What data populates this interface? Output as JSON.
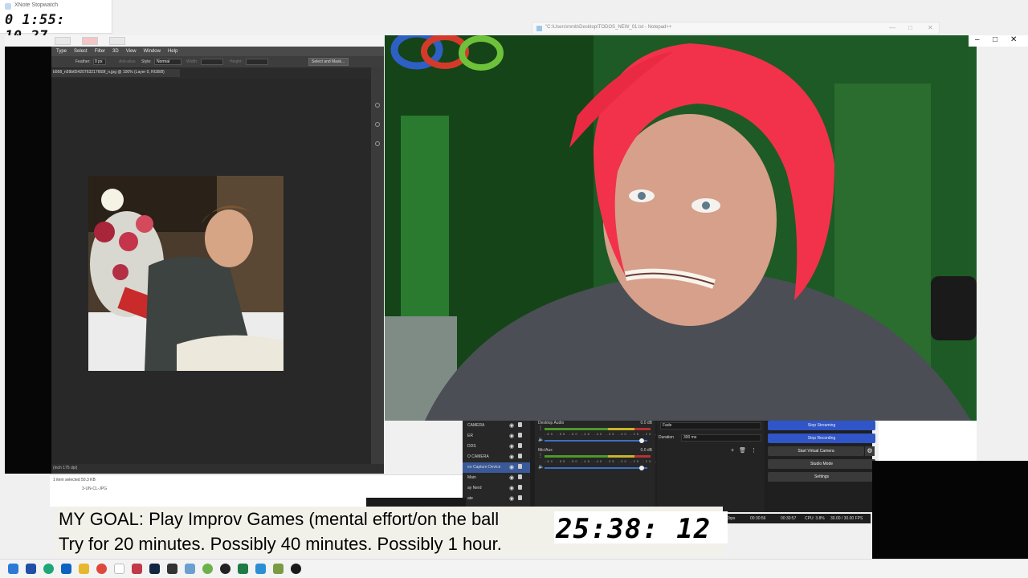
{
  "stopwatch": {
    "title": "XNote Stopwatch",
    "time": "0 1:55: 10.27"
  },
  "notepad": {
    "title": "\"C:\\Users\\mmb\\Desktop\\TODOS_NEW_01.txt - Notepad++"
  },
  "photoshop": {
    "menu": [
      "Type",
      "Select",
      "Filter",
      "3D",
      "View",
      "Window",
      "Help"
    ],
    "options": {
      "feather_label": "Feather:",
      "feather_value": "0 px",
      "antialias_label": "Anti-alias",
      "style_label": "Style:",
      "style_value": "Normal",
      "width_label": "Width:",
      "height_label": "Height:",
      "select_mask_button": "Select and Mask..."
    },
    "doc_tab": "b568_n59b65420763217669f_n.jpg @ 100% (Layer 0, RGB/8)",
    "status_zoom": "(inch 175 dpi)"
  },
  "explorer": {
    "status": "1 item selected 50.3 KB",
    "file": "3-UN-CL-JPG"
  },
  "obs": {
    "sources": [
      {
        "label": "CAMERA",
        "selected": false
      },
      {
        "label": "ER",
        "selected": false
      },
      {
        "label": "DDS",
        "selected": false
      },
      {
        "label": "O CAMERA",
        "selected": false
      },
      {
        "label": "eo Capture Device",
        "selected": true
      },
      {
        "label": "Main",
        "selected": false
      },
      {
        "label": "ay Nerd",
        "selected": false
      },
      {
        "label": "ate",
        "selected": false
      }
    ],
    "mixer": {
      "desktop_label": "Desktop Audio",
      "desktop_db": "0.0 dB",
      "mic_label": "Mic/Aux",
      "mic_db": "0.0 dB",
      "ticks": "-60 -55 -50 -45 -40 -35 -30 -25 -20 -15 -10 -5 0"
    },
    "transition": {
      "type": "Fade",
      "duration_label": "Duration",
      "duration_value": "300 ms"
    },
    "controls": {
      "stop_streaming": "Stop Streaming",
      "stop_recording": "Stop Recording",
      "start_virtual_camera": "Start Virtual Camera",
      "studio_mode": "Studio Mode",
      "settings": "Settings"
    },
    "status": {
      "kbps": "Kbps",
      "live_time": "00:30:56",
      "rec_time": "00:30:57",
      "cpu": "CPU: 3.8%",
      "fps": "30.00 / 30.00 FPS"
    }
  },
  "overlay": {
    "goal_line1": "MY GOAL: Play Improv Games (mental effort/on the ball",
    "goal_line2": "Try for 20 minutes. Possibly 40 minutes. Possibly 1 hour.",
    "countdown": "25:38: 12"
  },
  "colors": {
    "obs_active_button": "#2f55c8",
    "hair": "#f2324a",
    "wall_green": "#1d5a24"
  },
  "taskbar": {
    "icons": [
      "windows-start-icon",
      "vscode-icon",
      "edge-icon",
      "outlook-icon",
      "file-explorer-icon",
      "chrome-icon",
      "notepad-icon",
      "app-icon",
      "photoshop-icon",
      "terminal-icon",
      "python-icon",
      "app-icon",
      "obs-icon",
      "excel-icon",
      "photos-icon",
      "app-icon",
      "media-player-icon"
    ]
  }
}
